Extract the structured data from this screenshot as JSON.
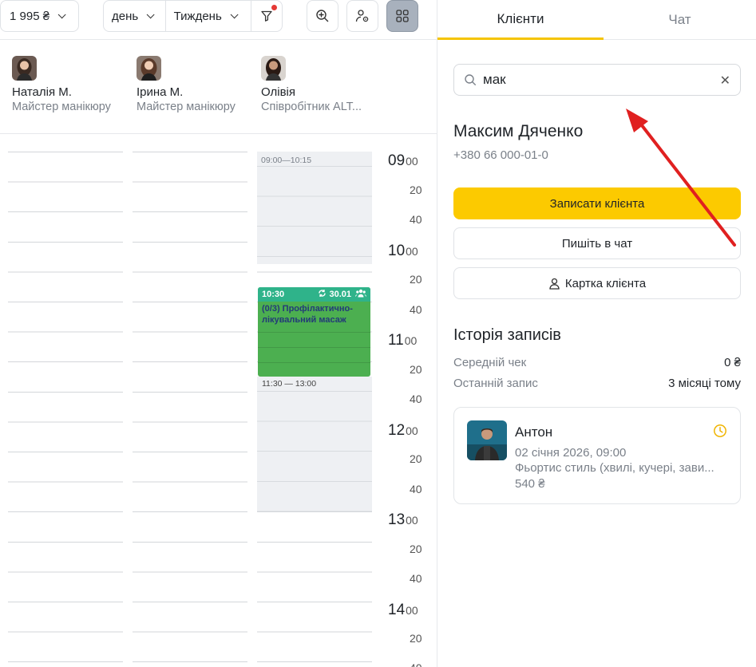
{
  "toolbar": {
    "price": "1 995 ₴",
    "view_day": "день",
    "view_week": "Тиждень"
  },
  "staff": [
    {
      "name": "Наталія М.",
      "role": "Майстер манікюру"
    },
    {
      "name": "Ірина М.",
      "role": "Майстер манікюру"
    },
    {
      "name": "Олівія",
      "role": "Співробітник ALT..."
    }
  ],
  "calendar": {
    "block1_label": "09:00—10:15",
    "block2_label": "11:30 — 13:00",
    "appointment": {
      "time": "10:30",
      "date": "30.01",
      "title": "(0/3) Профілактично-лікувальний масаж"
    },
    "hours": [
      {
        "h": "09",
        "m": "00"
      },
      {
        "h": "10",
        "m": "00"
      },
      {
        "h": "11",
        "m": "00"
      },
      {
        "h": "12",
        "m": "00"
      },
      {
        "h": "13",
        "m": "00"
      },
      {
        "h": "14",
        "m": "00"
      }
    ],
    "minute_20": "20",
    "minute_40": "40"
  },
  "panel": {
    "tab_clients": "Клієнти",
    "tab_chat": "Чат",
    "search_value": "мак",
    "client_name": "Максим Дяченко",
    "client_phone": "+380 66 000-01-0",
    "btn_book": "Записати клієнта",
    "btn_chat": "Пишіть в чат",
    "btn_card": "Картка клієнта",
    "history_title": "Історія записів",
    "avg_check_label": "Середній чек",
    "avg_check_value": "0 ₴",
    "last_visit_label": "Останній запис",
    "last_visit_value": "3 місяці тому",
    "visit": {
      "master": "Антон",
      "date": "02 січня 2026, 09:00",
      "service": "Фьортис стиль (хвилі, кучері, зави...",
      "price": "540 ₴"
    }
  },
  "colors": {
    "accent_yellow": "#fcca00",
    "appointment_green": "#4caf50",
    "appointment_header": "#2fb38a",
    "annotation_arrow": "#e02020"
  }
}
